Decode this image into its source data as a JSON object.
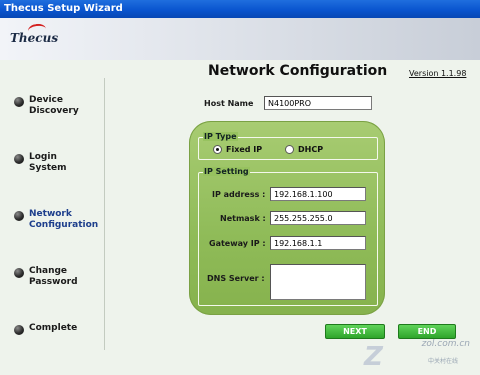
{
  "window": {
    "title": "Thecus Setup Wizard"
  },
  "brand": {
    "logo_text": "Thecus"
  },
  "sidebar": {
    "items": [
      {
        "label": "Device\nDiscovery",
        "active": false
      },
      {
        "label": "Login\nSystem",
        "active": false
      },
      {
        "label": "Network\nConfiguration",
        "active": true
      },
      {
        "label": "Change\nPassword",
        "active": false
      },
      {
        "label": "Complete",
        "active": false
      }
    ]
  },
  "header": {
    "title": "Network Configuration",
    "version": "Version 1.1.98"
  },
  "form": {
    "host_name": {
      "label": "Host Name",
      "value": "N4100PRO"
    },
    "ip_type": {
      "legend": "IP Type",
      "options": [
        {
          "label": "Fixed IP",
          "checked": true
        },
        {
          "label": "DHCP",
          "checked": false
        }
      ]
    },
    "ip_setting": {
      "legend": "IP Setting",
      "ip_address": {
        "label": "IP address :",
        "value": "192.168.1.100"
      },
      "netmask": {
        "label": "Netmask :",
        "value": "255.255.255.0"
      },
      "gateway": {
        "label": "Gateway IP :",
        "value": "192.168.1.1"
      },
      "dns": {
        "label": "DNS Server :",
        "value": ""
      }
    }
  },
  "buttons": {
    "next": "NEXT",
    "end": "END"
  },
  "watermark": {
    "site": "zol.com.cn",
    "cn": "中关村在线"
  },
  "colors": {
    "titlebar": "#0a55cf",
    "panel_green": "#8fbb58",
    "button_green": "#2fa52b",
    "background": "#eef3ec"
  }
}
